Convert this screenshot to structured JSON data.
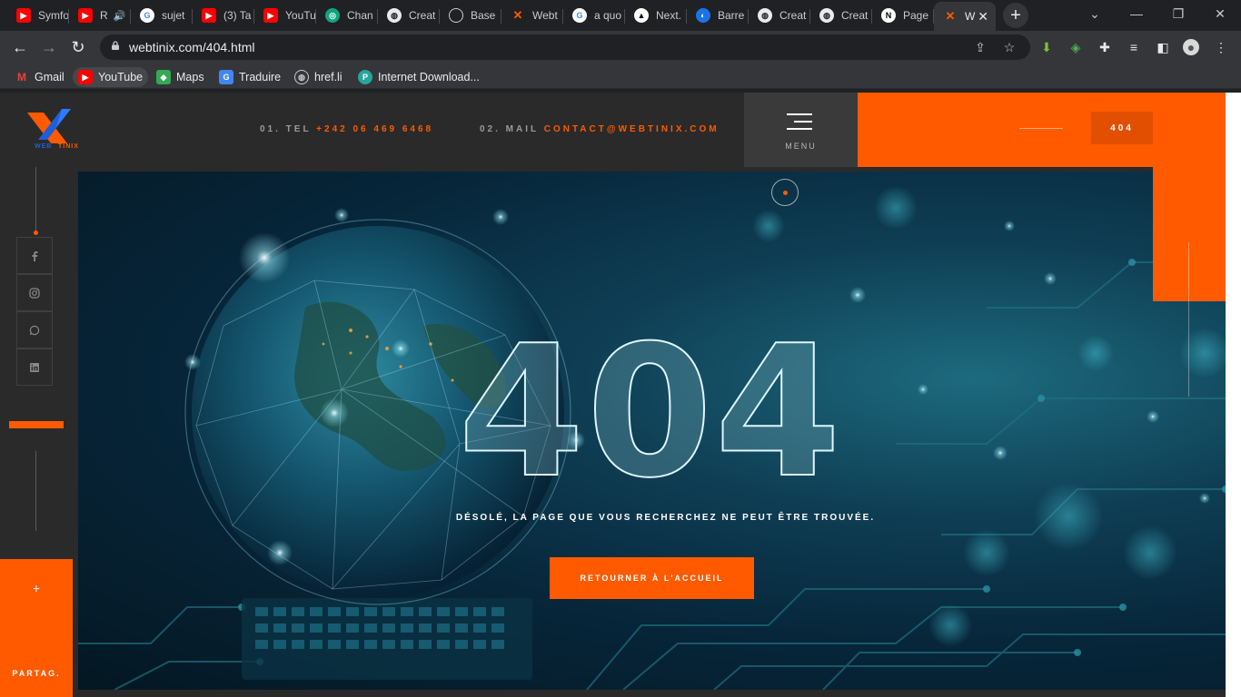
{
  "browser": {
    "tabs": [
      {
        "title": "Symfo",
        "icon": "youtube-icon"
      },
      {
        "title": "R",
        "icon": "youtube-icon"
      },
      {
        "title": "sujet",
        "icon": "google-icon"
      },
      {
        "title": "(3) Ta",
        "icon": "youtube-icon"
      },
      {
        "title": "YouTu",
        "icon": "youtube-icon"
      },
      {
        "title": "Chan",
        "icon": "chatgpt-icon"
      },
      {
        "title": "Creat",
        "icon": "globe-icon"
      },
      {
        "title": "Base",
        "icon": "github-icon"
      },
      {
        "title": "Webt",
        "icon": "webtinix-icon"
      },
      {
        "title": "a quo",
        "icon": "google-icon"
      },
      {
        "title": "Next.",
        "icon": "vercel-icon"
      },
      {
        "title": "Barre",
        "icon": "ball-icon"
      },
      {
        "title": "Creat",
        "icon": "globe-icon"
      },
      {
        "title": "Creat",
        "icon": "globe-icon"
      },
      {
        "title": "Page",
        "icon": "nextjs-icon"
      },
      {
        "title": "W",
        "icon": "webtinix-icon"
      }
    ],
    "url": "webtinix.com/404.html",
    "bookmarks": [
      {
        "label": "Gmail",
        "icon": "gmail-icon"
      },
      {
        "label": "YouTube",
        "icon": "youtube-icon"
      },
      {
        "label": "Maps",
        "icon": "maps-icon"
      },
      {
        "label": "Traduire",
        "icon": "translate-icon"
      },
      {
        "label": "href.li",
        "icon": "globe-icon"
      },
      {
        "label": "Internet Download...",
        "icon": "idm-icon"
      }
    ]
  },
  "site": {
    "contact_tel_label": "01. TEL",
    "contact_tel_value": "+242 06 469 6468",
    "contact_mail_label": "02. MAIL",
    "contact_mail_value": "CONTACT@WEBTINIX.COM",
    "menu_label": "MENU",
    "code_badge": "404",
    "logo_text_a": "WEB",
    "logo_text_b": "TINIX",
    "social": [
      "facebook-icon",
      "instagram-icon",
      "whatsapp-icon",
      "linkedin-icon"
    ],
    "share_plus": "+",
    "share_label": "PARTAG.",
    "hero": {
      "code": "404",
      "message": "DÉSOLÉ, LA PAGE QUE VOUS RECHERCHEZ NE PEUT ÊTRE TROUVÉE.",
      "button": "RETOURNER À L'ACCUEIL"
    }
  },
  "colors": {
    "accent": "#ff5a00",
    "header_bg": "#2a2a2a",
    "chrome_bg": "#202124",
    "toolbar_bg": "#35363a"
  }
}
